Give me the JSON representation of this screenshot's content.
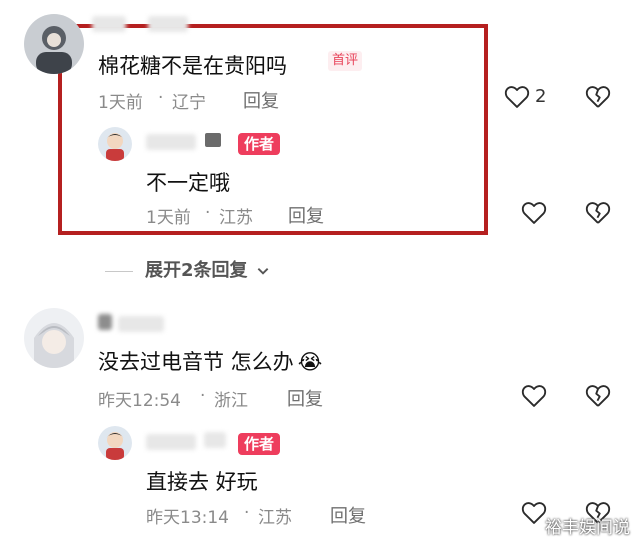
{
  "comments": [
    {
      "text": "棉花糖不是在贵阳吗",
      "badge": "首评",
      "time": "1天前",
      "location": "辽宁",
      "reply_label": "回复",
      "likes": "2",
      "reply": {
        "author_badge": "作者",
        "text": "不一定哦",
        "time": "1天前",
        "location": "江苏",
        "reply_label": "回复"
      }
    },
    {
      "text": "没去过电音节 怎么办",
      "emoji": "😭",
      "time": "昨天12:54",
      "location": "浙江",
      "reply_label": "回复",
      "reply": {
        "author_badge": "作者",
        "text": "直接去 好玩",
        "time": "昨天13:14",
        "location": "江苏",
        "reply_label": "回复"
      }
    }
  ],
  "expand_replies": "展开2条回复",
  "separator": "·",
  "watermark": "裕丰娱间说",
  "colors": {
    "highlight": "#b52020",
    "author_badge": "#ee3d5d",
    "first_badge_text": "#e8445a"
  },
  "icons": [
    "heart-outline-icon",
    "broken-heart-icon",
    "chevron-down-icon"
  ]
}
